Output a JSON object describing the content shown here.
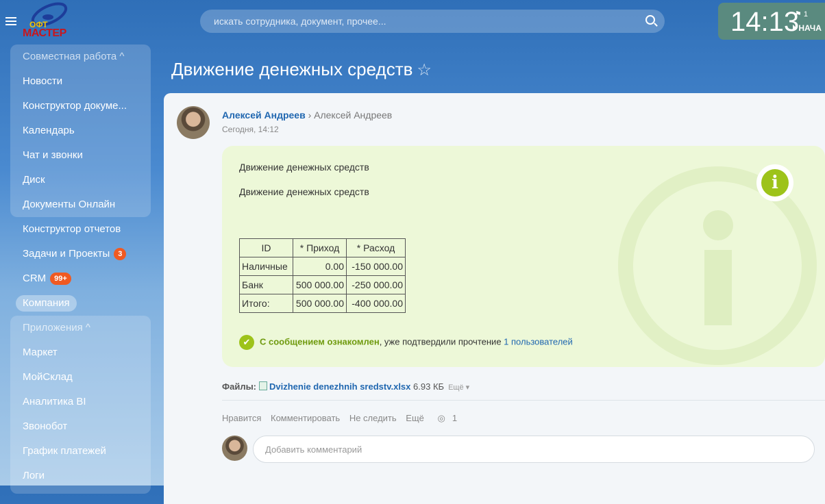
{
  "header": {
    "logo_text_top": "ОФТ",
    "logo_text": "МАСТЕР",
    "search_placeholder": "искать сотрудника, документ, прочее...",
    "time": "14:13",
    "flag_count": "1",
    "start_label": "НАЧА"
  },
  "sidebar": {
    "group1": "Совместная работа ^",
    "items1": [
      "Новости",
      "Конструктор докуме...",
      "Календарь",
      "Чат и звонки",
      "Диск",
      "Документы Онлайн"
    ],
    "items2": [
      {
        "label": "Конструктор отчетов"
      },
      {
        "label": "Задачи и Проекты",
        "badge": "3"
      },
      {
        "label": "CRM",
        "badge": "99+"
      },
      {
        "label": "Компания"
      }
    ],
    "group2": "Приложения ^",
    "items3": [
      "Маркет",
      "МойСклад",
      "Аналитика BI",
      "Звонобот",
      "График платежей",
      "Логи"
    ]
  },
  "page": {
    "title": "Движение денежных средств",
    "star": "☆"
  },
  "post": {
    "author": "Алексей Андреев",
    "arrow": "›",
    "recipient": "Алексей Андреев",
    "date": "Сегодня, 14:12",
    "msg_title": "Движение денежных средств",
    "msg_body": "Движение денежных средств",
    "table": {
      "headers": [
        "ID",
        "* Приход",
        "* Расход"
      ],
      "rows": [
        [
          "Наличные",
          "0.00",
          "-150 000.00"
        ],
        [
          "Банк",
          "500 000.00",
          "-250 000.00"
        ],
        [
          "Итого:",
          "500 000.00",
          "-400 000.00"
        ]
      ]
    },
    "confirm_bold": "С сообщением ознакомлен",
    "confirm_text": ", уже подтвердили прочтение ",
    "confirm_link": "1 пользователей",
    "files_label": "Файлы:",
    "file_name": "Dvizhenie denezhnih sredstv.xlsx",
    "file_size": "6.93 КБ",
    "file_more": "Ещё ▾",
    "actions": [
      "Нравится",
      "Комментировать",
      "Не следить",
      "Ещё"
    ],
    "views": "1",
    "comment_placeholder": "Добавить комментарий"
  }
}
